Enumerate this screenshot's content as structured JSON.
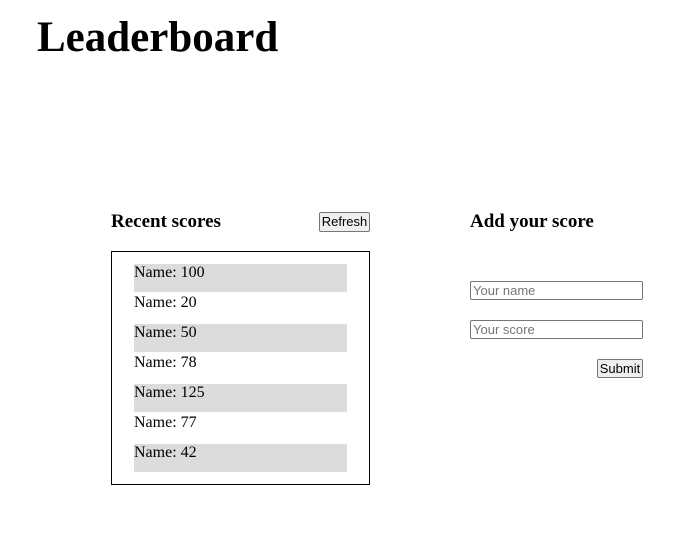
{
  "page": {
    "title": "Leaderboard"
  },
  "recent": {
    "heading": "Recent scores",
    "refresh_label": "Refresh",
    "scores": [
      {
        "label": "Name: 100"
      },
      {
        "label": "Name: 20"
      },
      {
        "label": "Name: 50"
      },
      {
        "label": "Name: 78"
      },
      {
        "label": "Name: 125"
      },
      {
        "label": "Name: 77"
      },
      {
        "label": "Name: 42"
      }
    ]
  },
  "add": {
    "heading": "Add your score",
    "name_placeholder": "Your name",
    "name_value": "",
    "score_placeholder": "Your score",
    "score_value": "",
    "submit_label": "Submit"
  },
  "colors": {
    "row_shade": "#dcdcdc",
    "border": "#000000"
  }
}
